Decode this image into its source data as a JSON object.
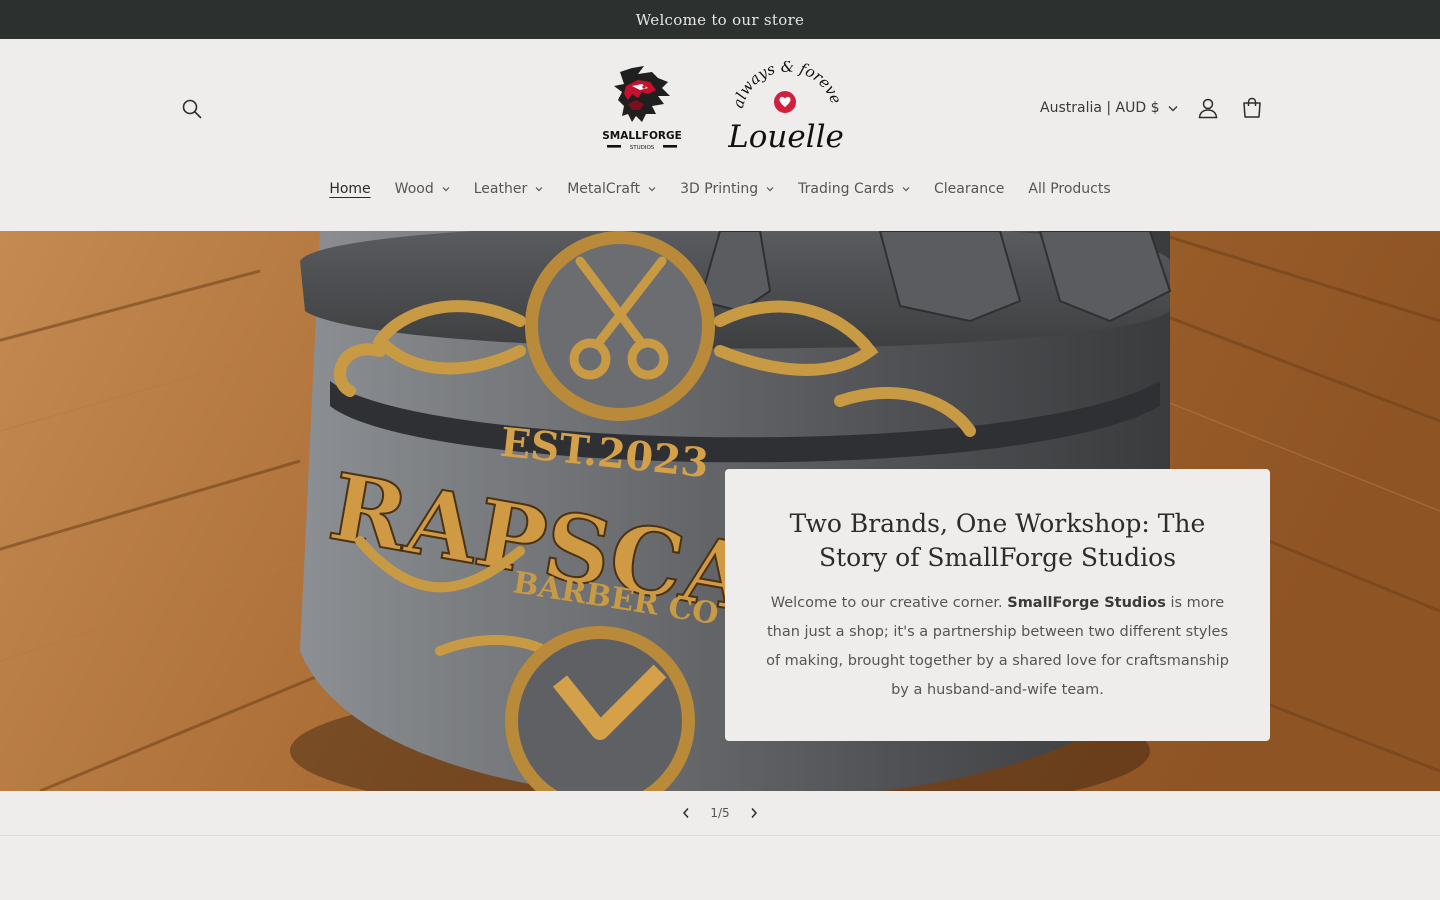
{
  "announcement": {
    "text": "Welcome to our store"
  },
  "header": {
    "logos": {
      "smallforge_text": "SMALLFORGE",
      "smallforge_sub": "STUDIOS",
      "louelle_top": "always & forever",
      "louelle_name": "Louelle"
    },
    "country_selector": "Australia | AUD $",
    "icons": {
      "search": "search-icon",
      "account": "account-icon",
      "cart": "cart-icon"
    }
  },
  "nav": {
    "items": [
      {
        "label": "Home",
        "dropdown": false,
        "active": true
      },
      {
        "label": "Wood",
        "dropdown": true
      },
      {
        "label": "Leather",
        "dropdown": true
      },
      {
        "label": "MetalCraft",
        "dropdown": true
      },
      {
        "label": "3D Printing",
        "dropdown": true
      },
      {
        "label": "Trading Cards",
        "dropdown": true
      },
      {
        "label": "Clearance",
        "dropdown": false
      },
      {
        "label": "All Products",
        "dropdown": false
      }
    ]
  },
  "hero": {
    "title": "Two Brands, One Workshop: The Story of SmallForge Studios",
    "text_before": "Welcome to our creative corner. ",
    "text_bold": "SmallForge Studios",
    "text_after": " is more than just a shop; it's a partnership between two different styles of making, brought together by a shared love for craftsmanship by a husband-and-wife team.",
    "image": {
      "banner_text": "RAPSCAL",
      "est_text": "EST.2023",
      "sub_text": "BARBER CO"
    }
  },
  "slideshow": {
    "counter": "1/5"
  },
  "colors": {
    "announcement_bg": "#2c302e",
    "page_bg": "#eeedeb",
    "accent_red": "#d21f3c"
  }
}
